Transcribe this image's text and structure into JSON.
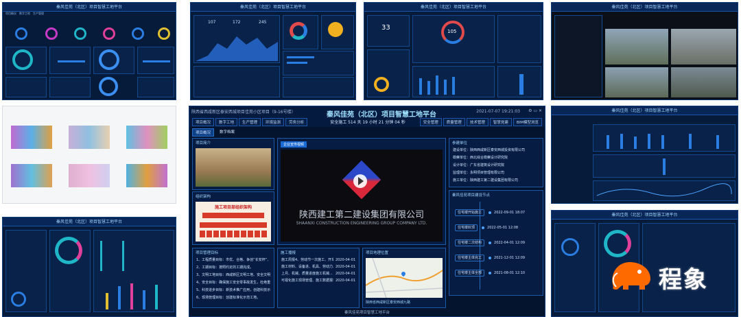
{
  "thumb_header": "秦风佳苑（北区）项目智慧工地平台",
  "center": {
    "site_name": "陕西省西咸新区泰安西城项目佳苑小区项目（9-16号楼）",
    "title": "秦风佳苑（北区）项目智慧工地平台",
    "datetime": "2021-07-07 19:21:03",
    "safety_text": "安全施工 514 天 19 小时 21 分钟 04 秒",
    "nav_left": [
      "项目概况",
      "数字工地",
      "生产管理",
      "环境监测",
      "劳务分析"
    ],
    "nav_right": [
      "安全管理",
      "质量管理",
      "技术管理",
      "智慧党建",
      "BIM模型浏览"
    ],
    "subtabs": [
      "项目概况",
      "数字档案"
    ],
    "panel_intro": {
      "title": "项目简介"
    },
    "panel_org": {
      "title": "组织架构",
      "banner": "施工项目部组织架构"
    },
    "panel_video": {
      "tag": "企业宣传视频",
      "company": "陕西建工第二建设集团有限公司",
      "company_en": "SHAANXI CONSTRUCTION ENGINEERING GROUP COMPANY LTD."
    },
    "panel_units": {
      "title": "参建单位",
      "rows": [
        "建设单位：陕西西咸新区泰安西城投资有限公司",
        "勘察单位：西北综合勘察设计研究院",
        "设计单位：广东省建筑设计研究院",
        "监理单位：永明项目管理有限公司",
        "施工单位：陕西建工第二建设集团有限公司"
      ]
    },
    "panel_nodes": {
      "title": "秦风佳苑项目建设节点",
      "events": [
        {
          "label": "住宅楼开始施工",
          "date": "2022-09-01 18:07"
        },
        {
          "label": "住宅楼封顶",
          "date": "2022-05-01 12:08"
        },
        {
          "label": "住宅楼二次结构",
          "date": "2022-04-01 12:09"
        },
        {
          "label": "住宅楼主体完工",
          "date": "2021-12-01 12:09"
        },
        {
          "label": "住宅楼主体全部",
          "date": "2021-08-01 12:10"
        }
      ]
    },
    "panel_goals": {
      "title": "项目管理目标",
      "lines": [
        "1、工程质量目标：市优、合格、争创“长安杯”、小区、内部，创建城市优质工程。",
        "2、工期目标：按照约定的工期完成。",
        "3、文明工地目标：西咸新区文明工地、安全文明工地。",
        "4、安全目标：确保施工安全零事故发生，杜绝重大伤亡事故。",
        "5、科技进步目标：新技术推广应用，创建科技示范工程。",
        "6、现场管理目标：创建标准化示范工地。"
      ]
    },
    "panel_news": {
      "title": "施工播报",
      "rows": [
        {
          "text": "施工周报4、劳动节一次施工、开车...",
          "date": "2020-04-01"
        },
        {
          "text": "施工材料、设备进、机具、劳动力...",
          "date": "2020-04-01"
        },
        {
          "text": "上月、机械、质量进度施工机械...",
          "date": "2020-04-01"
        },
        {
          "text": "可视化施工现场管理、施工数据报表...",
          "date": "2020-04-01"
        }
      ]
    },
    "panel_map": {
      "title": "项目地理位置",
      "caption": "陕西省西咸新区泰安西城九路"
    },
    "footer": "秦风佳苑项目智慧工地平台"
  },
  "thumb_top_left": {
    "numbers": [
      "107",
      "172",
      "245"
    ]
  },
  "thumb_weather": {
    "temp": "33",
    "aqi": "105"
  },
  "logo": {
    "text": "程象",
    "colors": {
      "brand": "#ff6a00",
      "text": "#ffffff"
    }
  },
  "colors": {
    "dash_bg": "#061a3a",
    "accent": "#2a7de1",
    "title": "#9fe0ff"
  }
}
